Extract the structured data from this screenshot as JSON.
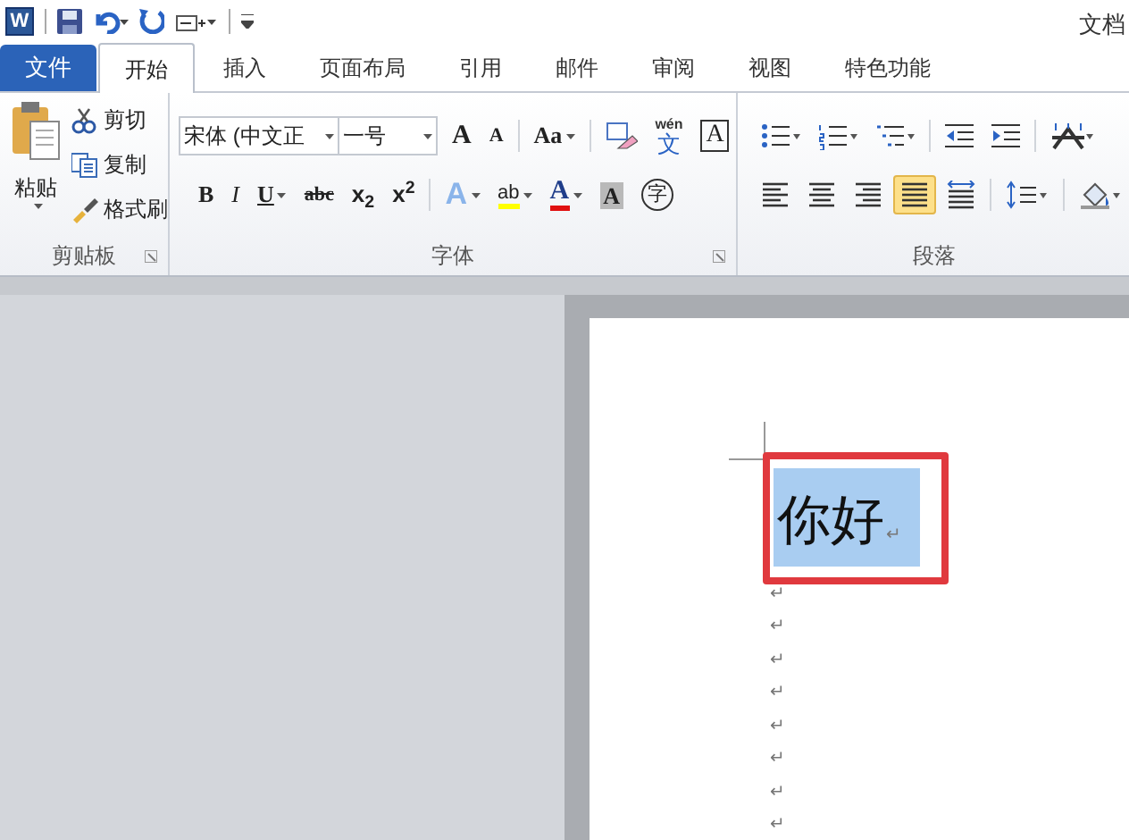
{
  "window": {
    "logo": "W",
    "title": "文档"
  },
  "quick_access": [
    {
      "kind": "save"
    },
    {
      "kind": "undo"
    },
    {
      "kind": "redo"
    },
    {
      "kind": "customize"
    }
  ],
  "tabs": [
    {
      "label": "文件",
      "kind": "file",
      "selected": false
    },
    {
      "label": "开始",
      "kind": "tab",
      "selected": true
    },
    {
      "label": "插入",
      "kind": "tab",
      "selected": false
    },
    {
      "label": "页面布局",
      "kind": "tab",
      "selected": false
    },
    {
      "label": "引用",
      "kind": "tab",
      "selected": false
    },
    {
      "label": "邮件",
      "kind": "tab",
      "selected": false
    },
    {
      "label": "审阅",
      "kind": "tab",
      "selected": false
    },
    {
      "label": "视图",
      "kind": "tab",
      "selected": false
    },
    {
      "label": "特色功能",
      "kind": "tab",
      "selected": false
    }
  ],
  "clipboard": {
    "label": "剪贴板",
    "paste": "粘贴",
    "items": [
      {
        "label": "剪切",
        "kind": "cut"
      },
      {
        "label": "复制",
        "kind": "copy"
      },
      {
        "label": "格式刷",
        "kind": "brush"
      }
    ]
  },
  "font": {
    "label": "字体",
    "font_name": "宋体 (中文正",
    "font_size": "一号",
    "row_1": [
      {
        "kind": "grow",
        "label": "A"
      },
      {
        "kind": "shrink",
        "label": "A"
      },
      {
        "kind": "sep"
      },
      {
        "kind": "case",
        "label": "Aa"
      },
      {
        "kind": "sep"
      },
      {
        "kind": "clear"
      },
      {
        "kind": "phonetic",
        "label": "wén",
        "label_2": "文"
      },
      {
        "kind": "border",
        "label": "A"
      }
    ],
    "row_2": [
      {
        "kind": "bold",
        "label": "B"
      },
      {
        "kind": "italic",
        "label": "I"
      },
      {
        "kind": "underline",
        "label": "U"
      },
      {
        "kind": "strike",
        "label": "abc"
      },
      {
        "kind": "sub",
        "label": "x$_{2}$"
      },
      {
        "kind": "sup",
        "label": "x$^{2}$"
      },
      {
        "kind": "sep"
      },
      {
        "kind": "effect",
        "label": "A"
      },
      {
        "kind": "highlight",
        "label": "ab"
      },
      {
        "kind": "color",
        "label": "A"
      },
      {
        "kind": "shade",
        "label": "A"
      },
      {
        "kind": "enclose",
        "label": "字"
      }
    ]
  },
  "paragraph": {
    "label": "段落",
    "row_1": [
      {
        "kind": "bullets"
      },
      {
        "kind": "numbering"
      },
      {
        "kind": "multilevel"
      },
      {
        "kind": "sep"
      },
      {
        "kind": "outdent"
      },
      {
        "kind": "indent"
      },
      {
        "kind": "sep"
      },
      {
        "kind": "asian"
      }
    ],
    "row_2": [
      {
        "kind": "left",
        "selected": false
      },
      {
        "kind": "center",
        "selected": false
      },
      {
        "kind": "right",
        "selected": false
      },
      {
        "kind": "justify",
        "selected": true
      },
      {
        "kind": "distributed",
        "selected": false
      },
      {
        "kind": "sep"
      },
      {
        "kind": "spacing"
      },
      {
        "kind": "sep"
      },
      {
        "kind": "fill"
      }
    ]
  },
  "document": {
    "paragraphs": [
      {
        "text": "你好",
        "mark": "↵",
        "selected": true
      },
      {
        "mark": "↵",
        "selected": false
      },
      {
        "mark": "↵",
        "selected": false
      },
      {
        "mark": "↵",
        "selected": false
      },
      {
        "mark": "↵",
        "selected": false
      },
      {
        "mark": "↵",
        "selected": false
      },
      {
        "mark": "↵",
        "selected": false
      },
      {
        "mark": "↵",
        "selected": false
      },
      {
        "mark": "↵",
        "selected": false
      }
    ]
  }
}
